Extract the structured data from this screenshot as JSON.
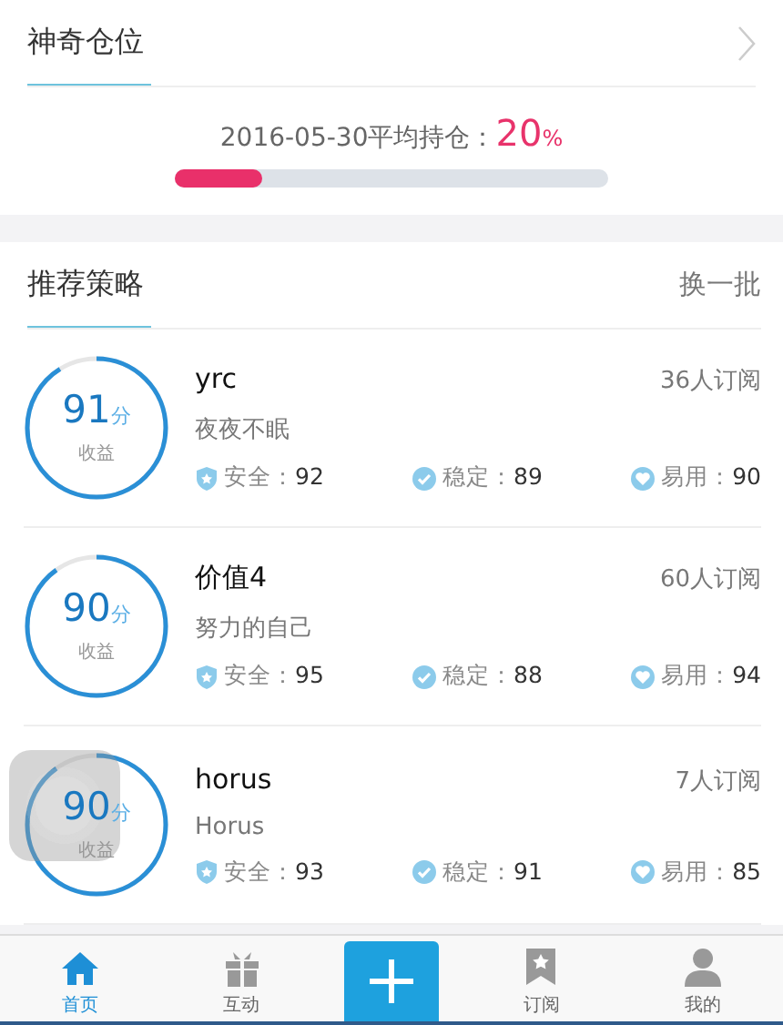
{
  "position_card": {
    "title": "神奇仓位",
    "summary_label": "2016-05-30平均持仓：",
    "summary_value": "20",
    "summary_unit": "%",
    "level": 0.2
  },
  "strategies_header": {
    "title": "推荐策略",
    "action": "换一批"
  },
  "strategies": [
    {
      "score": "91",
      "score_unit": "分",
      "score_label": "收益",
      "level": 0.91,
      "name": "yrc",
      "subscribers": "36人订阅",
      "description": "夜夜不眠",
      "metrics": [
        {
          "kind": "safety",
          "label": "安全：",
          "value": "92"
        },
        {
          "kind": "stability",
          "label": "稳定：",
          "value": "89"
        },
        {
          "kind": "ease",
          "label": "易用：",
          "value": "90"
        }
      ]
    },
    {
      "score": "90",
      "score_unit": "分",
      "score_label": "收益",
      "level": 0.9,
      "name": "价值4",
      "subscribers": "60人订阅",
      "description": "努力的自己",
      "metrics": [
        {
          "kind": "safety",
          "label": "安全：",
          "value": "95"
        },
        {
          "kind": "stability",
          "label": "稳定：",
          "value": "88"
        },
        {
          "kind": "ease",
          "label": "易用：",
          "value": "94"
        }
      ]
    },
    {
      "score": "90",
      "score_unit": "分",
      "score_label": "收益",
      "level": 0.9,
      "name": "horus",
      "subscribers": "7人订阅",
      "description": "Horus",
      "metrics": [
        {
          "kind": "safety",
          "label": "安全：",
          "value": "93"
        },
        {
          "kind": "stability",
          "label": "稳定：",
          "value": "91"
        },
        {
          "kind": "ease",
          "label": "易用：",
          "value": "85"
        }
      ]
    }
  ],
  "tab_bar": [
    {
      "kind": "home",
      "label": "首页",
      "selected": true
    },
    {
      "kind": "gift",
      "label": "互动",
      "selected": false
    },
    {
      "kind": "plus"
    },
    {
      "kind": "bookmark",
      "label": "订阅",
      "selected": false
    },
    {
      "kind": "person",
      "label": "我的",
      "selected": false
    }
  ]
}
